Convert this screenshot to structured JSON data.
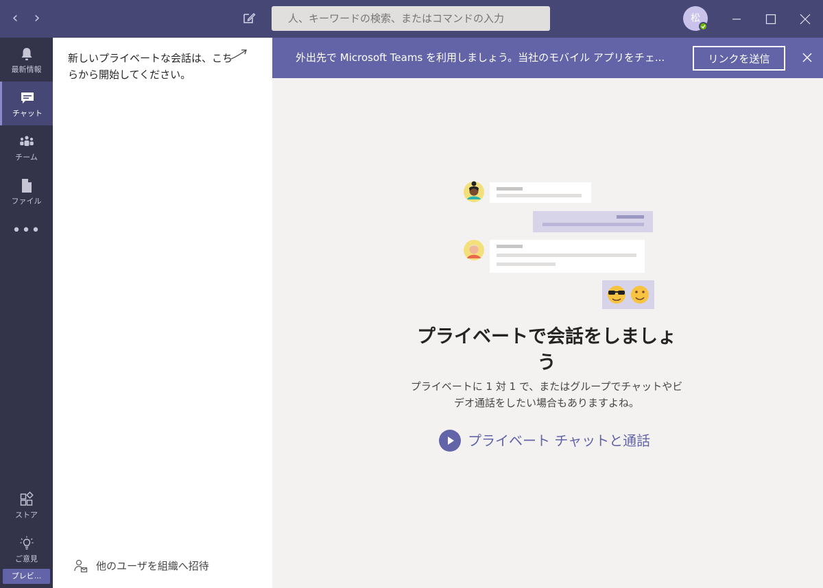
{
  "titlebar": {
    "back_label": "‹",
    "forward_label": "›",
    "search_placeholder": "人、キーワードの検索、またはコマンドの入力",
    "avatar_initial": "松",
    "presence_status": "available"
  },
  "rail": {
    "items": [
      {
        "label": "最新情報",
        "icon": "bell-icon"
      },
      {
        "label": "チャット",
        "icon": "chat-icon",
        "active": true
      },
      {
        "label": "チーム",
        "icon": "teams-icon"
      },
      {
        "label": "ファイル",
        "icon": "file-icon"
      }
    ],
    "more_label": "•••",
    "bottom_items": [
      {
        "label": "ストア",
        "icon": "store-icon"
      },
      {
        "label": "ご意見",
        "icon": "lightbulb-icon"
      }
    ],
    "preview_label": "プレビ..."
  },
  "list_pane": {
    "hint": "新しいプライベートな会話は、こちらから開始してください。",
    "invite_label": "他のユーザを組織へ招待"
  },
  "banner": {
    "text": "外出先で Microsoft Teams を利用しましょう。当社のモバイル アプリをチェ...",
    "button_label": "リンクを送信"
  },
  "empty_state": {
    "title": "プライベートで会話をしましょう",
    "description": "プライベートに 1 対 1 で、またはグループでチャットやビデオ通話をしたい場合もありますよね。",
    "cta_label": "プライベート チャットと通話"
  },
  "colors": {
    "titlebar": "#464775",
    "rail": "#33344a",
    "accent": "#6264a7",
    "background": "#f3f2f1"
  }
}
